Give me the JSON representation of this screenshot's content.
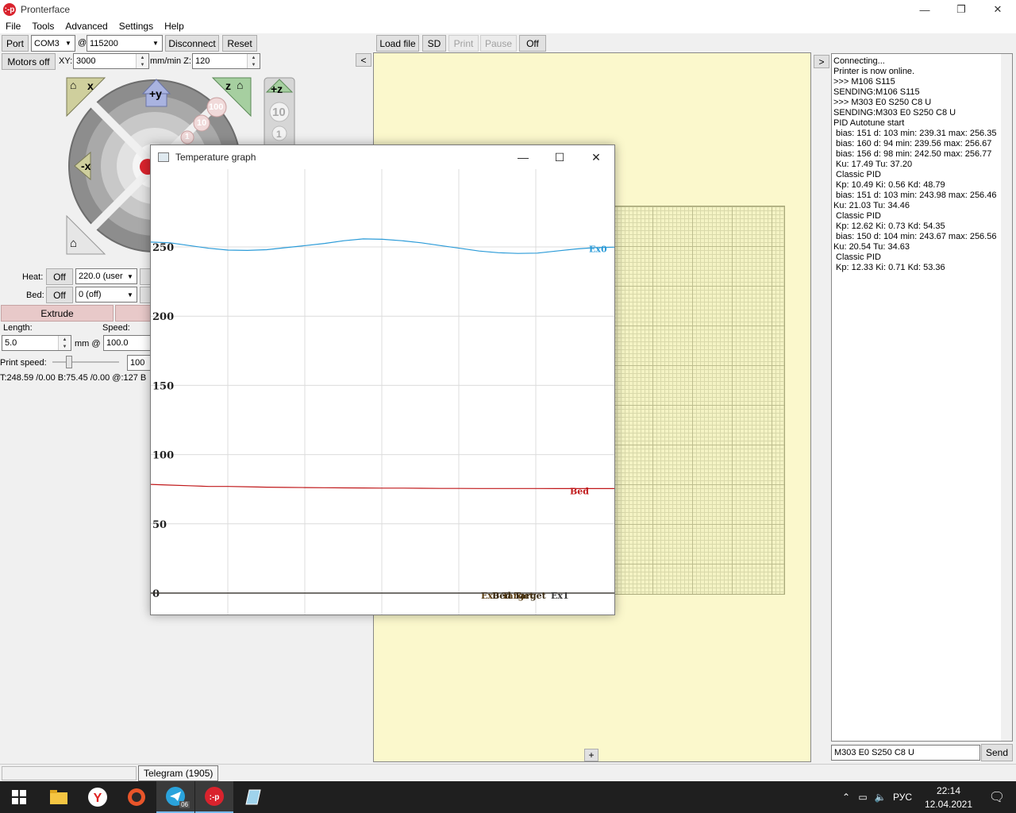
{
  "window": {
    "title": "Pronterface",
    "minimize": "—",
    "maximize": "❐",
    "close": "✕"
  },
  "menu": [
    "File",
    "Tools",
    "Advanced",
    "Settings",
    "Help"
  ],
  "toolbar": {
    "port_label": "Port",
    "port_value": "COM3",
    "at": "@",
    "baud_value": "115200",
    "disconnect": "Disconnect",
    "reset": "Reset",
    "motors_off": "Motors off",
    "xy_label": "XY:",
    "xy_value": "3000",
    "mmmin_z": "mm/min Z:",
    "z_value": "120",
    "load_file": "Load file",
    "sd": "SD",
    "print": "Print",
    "pause": "Pause",
    "off": "Off",
    "left_arrow": "<",
    "right_arrow": ">"
  },
  "jog": {
    "home_x": "x",
    "home_z": "z",
    "plus_y": "+y",
    "minus_x": "-x",
    "plus_z": "+z",
    "step_100": "100",
    "step_10": "10",
    "step_1": "1",
    "z_10": "10",
    "z_1": "1"
  },
  "temp": {
    "heat_label": "Heat:",
    "heat_off": "Off",
    "heat_value": "220.0 (user",
    "bed_label": "Bed:",
    "bed_off": "Off",
    "bed_value": "0 (off)",
    "extrude": "Extrude",
    "length_label": "Length:",
    "speed_label": "Speed:",
    "length_value": "5.0",
    "mm_at": "mm @",
    "speed_value": "100.0",
    "print_speed_label": "Print speed:",
    "print_speed_value": "100",
    "print_speed_fraction": 0.25,
    "status": "T:248.59 /0.00 B:75.45 /0.00 @:127 B"
  },
  "console": {
    "lines": [
      "Connecting...",
      "Printer is now online.",
      ">>> M106 S115",
      "SENDING:M106 S115",
      ">>> M303 E0 S250 C8 U",
      "SENDING:M303 E0 S250 C8 U",
      "PID Autotune start",
      " bias: 151 d: 103 min: 239.31 max: 256.35",
      " bias: 160 d: 94 min: 239.56 max: 256.67",
      " bias: 156 d: 98 min: 242.50 max: 256.77",
      " Ku: 17.49 Tu: 37.20",
      " Classic PID",
      " Kp: 10.49 Ki: 0.56 Kd: 48.79",
      " bias: 151 d: 103 min: 243.98 max: 256.46",
      "Ku: 21.03 Tu: 34.46",
      " Classic PID",
      " Kp: 12.62 Ki: 0.73 Kd: 54.35",
      " bias: 150 d: 104 min: 243.67 max: 256.56",
      "Ku: 20.54 Tu: 34.63",
      " Classic PID",
      " Kp: 12.33 Ki: 0.71 Kd: 53.36"
    ],
    "input_value": "M303 E0 S250 C8 U",
    "send": "Send",
    "plus": "+"
  },
  "tempgraph": {
    "title": "Temperature graph",
    "minimize": "—",
    "maximize": "☐",
    "close": "✕"
  },
  "chart_data": {
    "type": "line",
    "title": "",
    "xlabel": "",
    "ylabel": "",
    "ylim": [
      0,
      250
    ],
    "yticks": [
      0,
      50,
      100,
      150,
      200,
      250
    ],
    "grid": true,
    "x": [
      0,
      1,
      2,
      3,
      4,
      5,
      6,
      7,
      8,
      9,
      10,
      11,
      12,
      13,
      14,
      15,
      16,
      17,
      18,
      19,
      20,
      21,
      22,
      23,
      24
    ],
    "series": [
      {
        "name": "Ex0",
        "color": "#2b9bd8",
        "values": [
          253.5,
          253,
          251,
          249,
          247.7,
          247.5,
          248,
          249.5,
          251,
          252.5,
          254.5,
          255.8,
          255.5,
          254.5,
          253,
          251,
          249,
          247,
          245.8,
          245.3,
          245.5,
          247,
          248.5,
          249.5,
          249.8
        ]
      },
      {
        "name": "Bed",
        "color": "#c0191b",
        "values": [
          78.5,
          78,
          77.5,
          77,
          77,
          76.8,
          76.5,
          76.3,
          76.2,
          76.1,
          76,
          75.9,
          75.8,
          75.8,
          75.7,
          75.6,
          75.6,
          75.5,
          75.5,
          75.5,
          75.5,
          75.45,
          75.45,
          75.45,
          75.45
        ]
      },
      {
        "name": "Ex0 Target",
        "color": "#5a3d12",
        "values": [
          0,
          0,
          0,
          0,
          0,
          0,
          0,
          0,
          0,
          0,
          0,
          0,
          0,
          0,
          0,
          0,
          0,
          0,
          0,
          0,
          0,
          0,
          0,
          0,
          0
        ]
      },
      {
        "name": "Ex1",
        "color": "#3a3a3a",
        "values": [
          0,
          0,
          0,
          0,
          0,
          0,
          0,
          0,
          0,
          0,
          0,
          0,
          0,
          0,
          0,
          0,
          0,
          0,
          0,
          0,
          0,
          0,
          0,
          0,
          0
        ]
      }
    ],
    "overlap_label": "Bed Target"
  },
  "taskbar": {
    "tooltip": "Telegram (1905)",
    "telegram_badge": "06",
    "lang": "РУС",
    "time": "22:14",
    "date": "12.04.2021"
  }
}
